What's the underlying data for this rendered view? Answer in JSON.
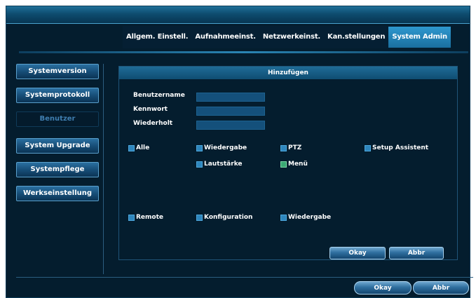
{
  "tabs": [
    {
      "label": "Allgem. Einstell.",
      "active": false
    },
    {
      "label": "Aufnahmeeinst.",
      "active": false
    },
    {
      "label": "Netzwerkeinst.",
      "active": false
    },
    {
      "label": "Kan.stellungen",
      "active": false
    },
    {
      "label": "System Admin",
      "active": true
    }
  ],
  "sidebar": {
    "items": [
      {
        "label": "Systemversion",
        "selected": false
      },
      {
        "label": "Systemprotokoll",
        "selected": false
      },
      {
        "label": "Benutzer",
        "selected": true
      },
      {
        "label": "System Upgrade",
        "selected": false
      },
      {
        "label": "Systempflege",
        "selected": false
      },
      {
        "label": "Werkseinstellung",
        "selected": false
      }
    ]
  },
  "dialog": {
    "title": "Hinzufügen",
    "fields": {
      "username_label": "Benutzername",
      "password_label": "Kennwort",
      "repeat_label": "Wiederholt",
      "username_value": "",
      "password_value": "",
      "repeat_value": ""
    },
    "permissions": {
      "all": "Alle",
      "playback": "Wiedergabe",
      "ptz": "PTZ",
      "setup_assistant": "Setup Assistent",
      "volume": "Lautstärke",
      "menu": "Menü",
      "remote": "Remote",
      "configuration": "Konfiguration",
      "remote_playback": "Wiedergabe"
    },
    "ok_label": "Okay",
    "cancel_label": "Abbr"
  },
  "footer": {
    "ok_label": "Okay",
    "cancel_label": "Abbr"
  },
  "colors": {
    "background": "#041d2e",
    "accent": "#2e98cf",
    "checkbox": "#2e86bd",
    "checkbox_green": "#3aa873"
  }
}
